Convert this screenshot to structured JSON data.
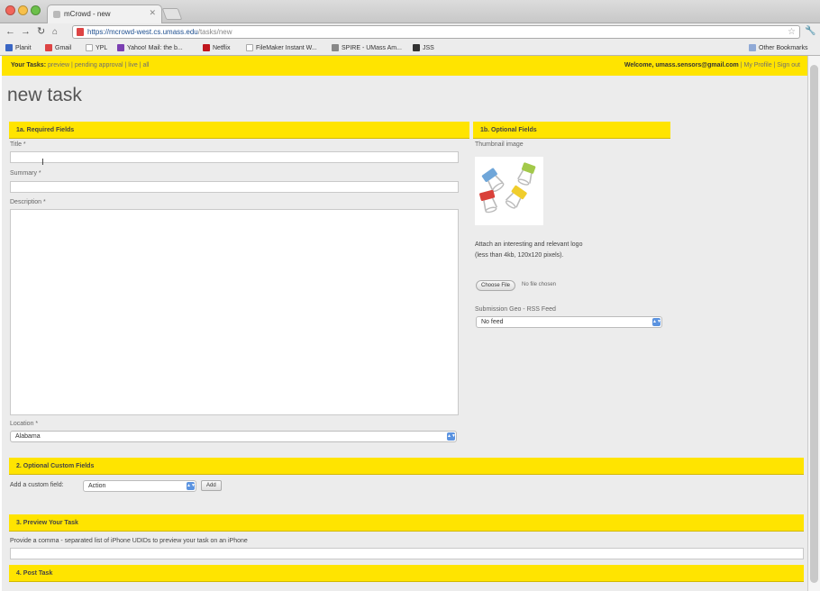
{
  "browser": {
    "tab_title": "mCrowd - new",
    "url_scheme": "https://",
    "url_host": "mcrowd-west.cs.umass.edu",
    "url_path": "/tasks/new",
    "bookmarks": [
      {
        "label": "Planit",
        "color": "#3a66c4"
      },
      {
        "label": "Gmail",
        "color": "#d44"
      },
      {
        "label": "YPL",
        "color": "#aaa"
      },
      {
        "label": "Yahoo! Mail: the b...",
        "color": "#7b3fb2"
      },
      {
        "label": "Netflix",
        "color": "#c0161d"
      },
      {
        "label": "FileMaker Instant W...",
        "color": "#777"
      },
      {
        "label": "SPIRE - UMass Am...",
        "color": "#777"
      },
      {
        "label": "JSS",
        "color": "#333"
      }
    ],
    "other_bookmarks": "Other Bookmarks"
  },
  "topnav": {
    "your_tasks": "Your Tasks:",
    "links": "preview | pending approval | live | all",
    "welcome": "Welcome, umass.sensors@gmail.com",
    "right_links": "| My Profile | Sign out"
  },
  "page": {
    "title": "new task"
  },
  "required": {
    "header": "1a. Required Fields",
    "title_label": "Title *",
    "summary_label": "Summary *",
    "description_label": "Description *",
    "location_label": "Location *",
    "location_value": "Alabama"
  },
  "optional": {
    "header": "1b. Optional Fields",
    "thumbnail_label": "Thumbnail image",
    "attach_text": "Attach an interesting and relevant logo (less than 4kb, 120x120 pixels).",
    "choose_file": "Choose File",
    "no_file": "No file chosen",
    "feed_label": "Submission Geo - RSS Feed",
    "feed_value": "No feed"
  },
  "custom": {
    "header": "2. Optional Custom Fields",
    "add_label": "Add a custom field:",
    "select_value": "Action",
    "add_button": "Add"
  },
  "preview": {
    "header": "3. Preview Your Task",
    "help": "Provide a comma - separated list of iPhone UDIDs to preview your task on an iPhone"
  },
  "post": {
    "header": "4. Post Task"
  }
}
